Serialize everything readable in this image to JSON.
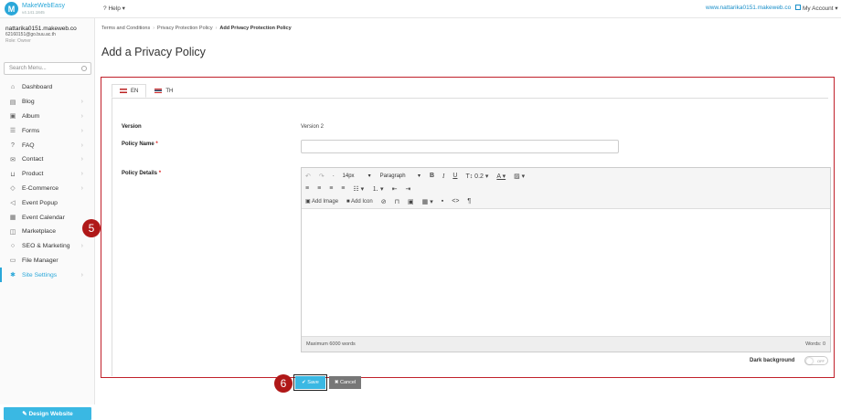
{
  "topbar": {
    "logo_name": "MakeWebEasy",
    "logo_version": "v4.141.1845",
    "help_label": "Help",
    "site_link": "www.nattarika0151.makeweb.co",
    "account_label": "My Account"
  },
  "user": {
    "name": "nattarika0151.makeweb.co",
    "email": "62160151@go.buu.ac.th",
    "role": "Role: Owner"
  },
  "sidebar": {
    "search_placeholder": "Search Menu...",
    "items": [
      {
        "label": "Dashboard",
        "icon": "home-icon"
      },
      {
        "label": "Blog",
        "icon": "document-icon"
      },
      {
        "label": "Album",
        "icon": "image-icon"
      },
      {
        "label": "Forms",
        "icon": "list-icon"
      },
      {
        "label": "FAQ",
        "icon": "question-icon"
      },
      {
        "label": "Contact",
        "icon": "mail-icon"
      },
      {
        "label": "Product",
        "icon": "cart-icon"
      },
      {
        "label": "E-Commerce",
        "icon": "tag-icon"
      },
      {
        "label": "Event Popup",
        "icon": "megaphone-icon"
      },
      {
        "label": "Event Calendar",
        "icon": "calendar-icon"
      },
      {
        "label": "Marketplace",
        "icon": "bag-icon"
      },
      {
        "label": "SEO & Marketing",
        "icon": "search-icon"
      },
      {
        "label": "File Manager",
        "icon": "folder-icon"
      },
      {
        "label": "Site Settings",
        "icon": "gear-icon"
      }
    ],
    "design_button": "Design Website"
  },
  "breadcrumb": [
    "Terms and Conditions",
    "Privacy Protection Policy",
    "Add Privacy Protection Policy"
  ],
  "page_title": "Add a Privacy Policy",
  "tabs": [
    "EN",
    "TH"
  ],
  "form": {
    "version_label": "Version",
    "version_value": "Version 2",
    "name_label": "Policy Name",
    "details_label": "Policy Details",
    "required_mark": "*"
  },
  "editor": {
    "font_size": "14px",
    "paragraph": "Paragraph",
    "line_height": "0.2",
    "add_image": "Add Image",
    "add_icon": "Add Icon",
    "max_words": "Maximum 6000 words",
    "word_count": "Words: 0"
  },
  "dark_background_label": "Dark background",
  "toggle_state": "OFF",
  "steps": [
    "5",
    "6"
  ],
  "buttons": {
    "save": "Save",
    "cancel": "Cancel"
  },
  "colors": {
    "accent": "#2aa7d9",
    "highlight": "#c0202a"
  }
}
